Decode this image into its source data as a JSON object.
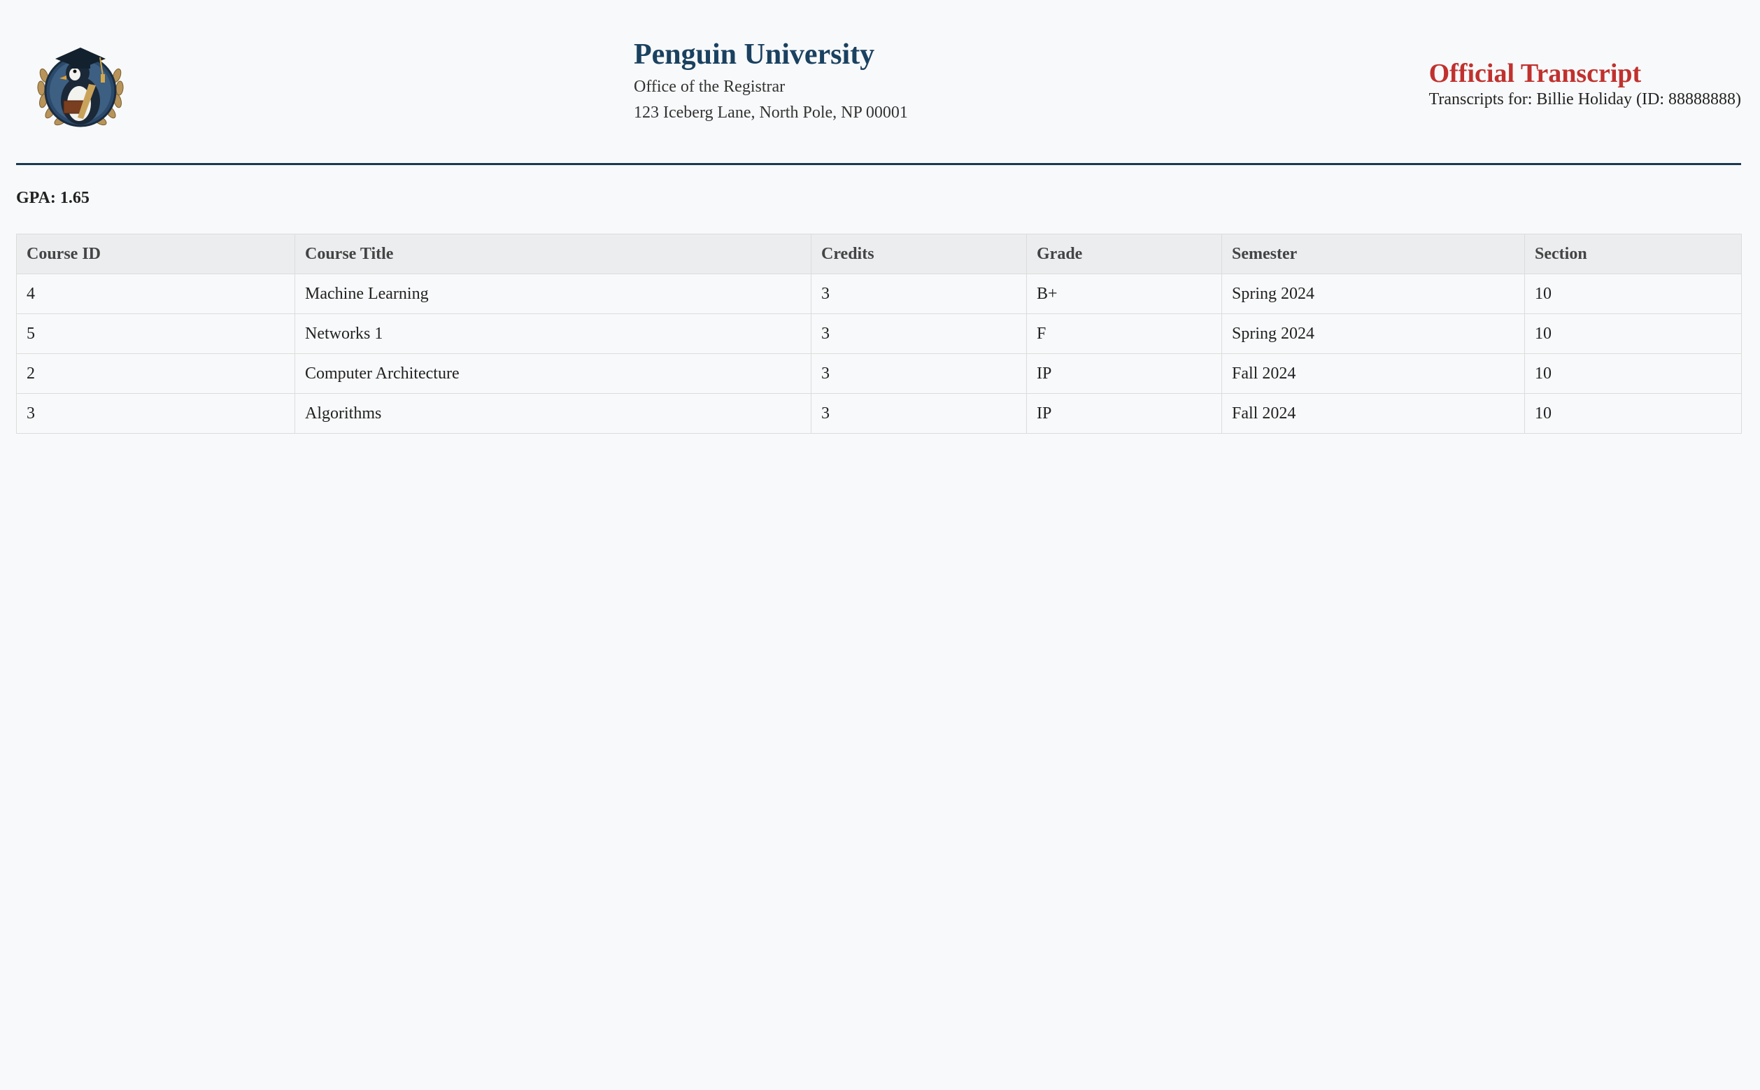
{
  "header": {
    "university_name": "Penguin University",
    "office": "Office of the Registrar",
    "address": "123 Iceberg Lane, North Pole, NP 00001",
    "document_title": "Official Transcript",
    "transcript_for": "Transcripts for: Billie Holiday (ID: 88888888)",
    "logo_icon": "penguin-graduate-seal-icon"
  },
  "summary": {
    "gpa_label": "GPA:",
    "gpa_value": "1.65"
  },
  "table": {
    "columns": [
      "Course ID",
      "Course Title",
      "Credits",
      "Grade",
      "Semester",
      "Section"
    ],
    "rows": [
      [
        "4",
        "Machine Learning",
        "3",
        "B+",
        "Spring 2024",
        "10"
      ],
      [
        "5",
        "Networks 1",
        "3",
        "F",
        "Spring 2024",
        "10"
      ],
      [
        "2",
        "Computer Architecture",
        "3",
        "IP",
        "Fall 2024",
        "10"
      ],
      [
        "3",
        "Algorithms",
        "3",
        "IP",
        "Fall 2024",
        "10"
      ]
    ]
  },
  "colors": {
    "brand_navy": "#1a4160",
    "title_red": "#c0312e",
    "divider": "#1a3a52",
    "background": "#f8f9fa",
    "header_row": "#ecedef"
  }
}
